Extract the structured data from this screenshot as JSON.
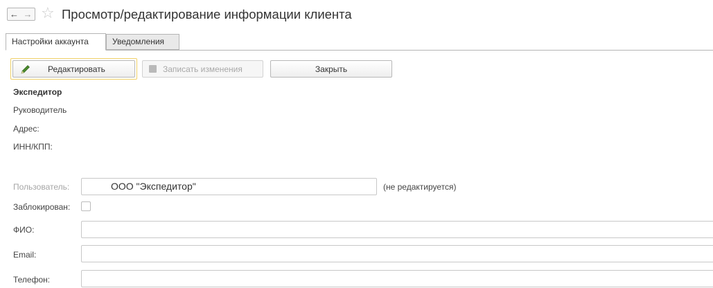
{
  "header": {
    "back_icon": "←",
    "forward_icon": "→",
    "star_icon": "☆",
    "title": "Просмотр/редактирование информации клиента"
  },
  "tabs": [
    {
      "label": "Настройки аккаунта",
      "active": true
    },
    {
      "label": "Уведомления",
      "active": false
    }
  ],
  "toolbar": {
    "edit_label": "Редактировать",
    "save_label": "Записать изменения",
    "close_label": "Закрыть"
  },
  "info": {
    "company": "Экспедитор",
    "manager_label": "Руководитель",
    "address_label": "Адрес:",
    "inn_label": "ИНН/КПП:"
  },
  "form": {
    "user_label": "Пользователь:",
    "user_value": "ООО \"Экспедитор\"",
    "user_note": "(не редактируется)",
    "blocked_label": "Заблокирован:",
    "blocked_checked": false,
    "fio_label": "ФИО:",
    "fio_value": "",
    "email_label": "Email:",
    "email_value": "",
    "phone_label": "Телефон:",
    "phone_value": ""
  },
  "colors": {
    "accent_border": "#f0d068",
    "pencil_green": "#4a8a2c"
  }
}
